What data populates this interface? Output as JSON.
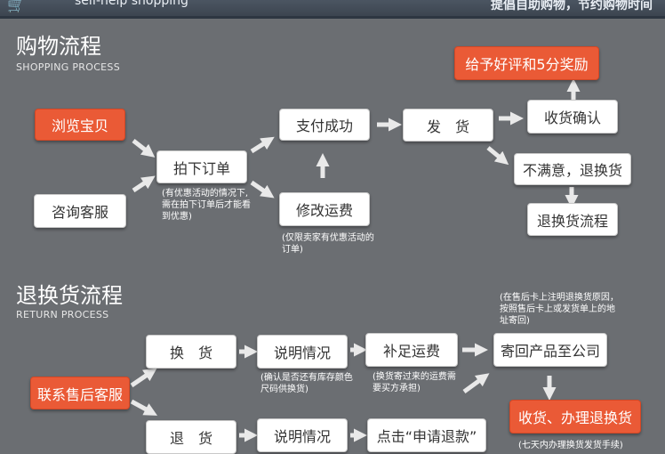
{
  "header": {
    "cart_icon": "cart-icon",
    "slogan_en": "self-help shopping",
    "slogan_cn": "提倡自助购物，节约购物时间"
  },
  "shopping": {
    "title": "购物流程",
    "subtitle": "SHOPPING PROCESS",
    "browse": "浏览宝贝",
    "consult": "咨询客服",
    "order": "拍下订单",
    "order_note": "(有优惠活动的情况下,需在拍下订单后才能看到优惠)",
    "pay": "支付成功",
    "modify": "修改运费",
    "modify_note": "(仅限卖家有优惠活动的订单)",
    "ship": "发　货",
    "confirm": "收货确认",
    "review": "给予好评和5分奖励",
    "unsatisfied": "不满意，退换货",
    "return_flow": "退换货流程"
  },
  "returns": {
    "title": "退换货流程",
    "subtitle": "RETURN PROCESS",
    "contact": "联系售后客服",
    "exchange": "换　货",
    "refund": "退　货",
    "explain1": "说明情况",
    "explain1_note": "(确认是否还有库存颜色尺码供换货)",
    "explain2": "说明情况",
    "supplement": "补足运费",
    "supplement_note": "(换货寄过来的运费需要买方承担)",
    "apply_refund": "点击“申请退款”",
    "send_back_note": "(在售后卡上注明退换货原因，按照售后卡上或发货单上的地址寄回)",
    "send_back": "寄回产品至公司",
    "receive": "收货、办理退换货",
    "bottom_note": "(七天内办理换货发货手续)"
  },
  "colors": {
    "background": "#6b6e72",
    "accent_red": "#ea5a36",
    "box": "#ffffff"
  }
}
